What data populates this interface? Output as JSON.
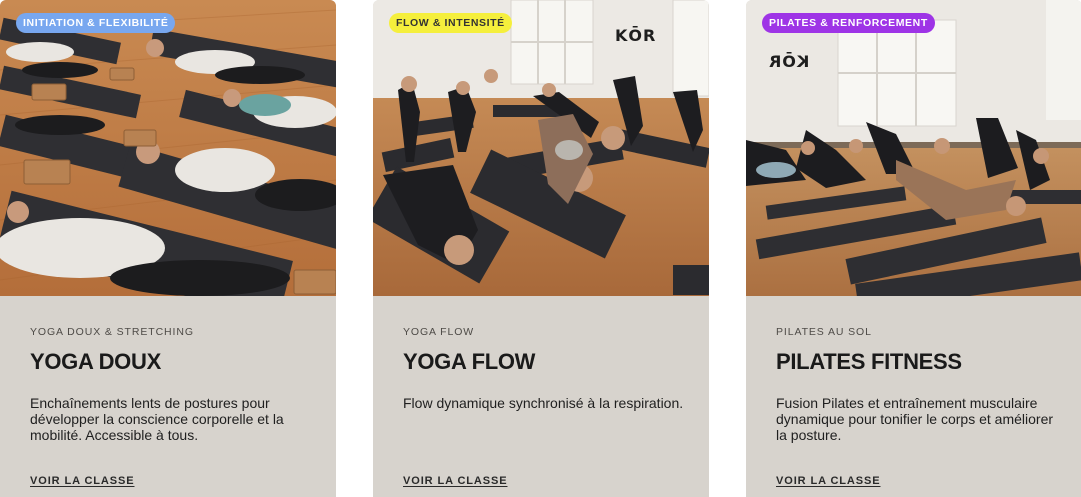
{
  "cards": [
    {
      "badge": "INITIATION & FLEXIBILITÉ",
      "eyebrow": "YOGA DOUX & STRETCHING",
      "title": "YOGA DOUX",
      "description": "Enchaînements lents de postures pour développer la conscience corporelle et la mobilité. Accessible à tous.",
      "cta": "VOIR LA CLASSE",
      "badge_color": "#78a7ef"
    },
    {
      "badge": "FLOW & INTENSITÉ",
      "eyebrow": "YOGA FLOW",
      "title": "YOGA FLOW",
      "description": "Flow dynamique synchronisé à la respiration.",
      "cta": "VOIR LA CLASSE",
      "logo": "KŌR",
      "badge_color": "#f5ef3c"
    },
    {
      "badge": "PILATES & RENFORCEMENT",
      "eyebrow": "PILATES AU SOL",
      "title": "PILATES FITNESS",
      "description": "Fusion Pilates et entraînement musculaire dynamique pour tonifier le corps et améliorer la posture.",
      "cta": "VOIR LA CLASSE",
      "logo": "KŌR",
      "badge_color": "#9e34e6"
    }
  ],
  "card_background": "#d7d3cd"
}
